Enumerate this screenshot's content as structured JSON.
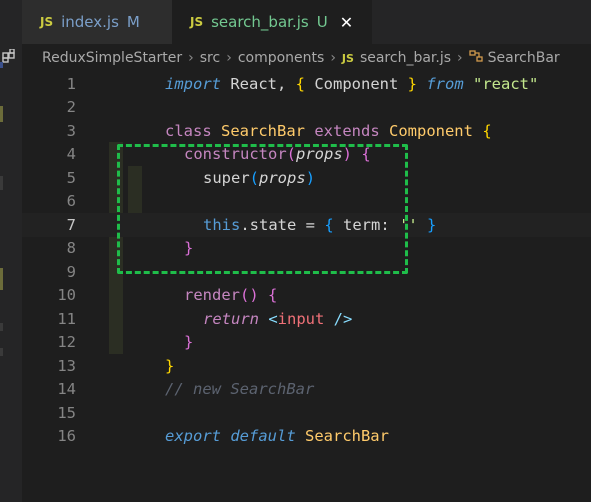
{
  "tabs": [
    {
      "badge": "JS",
      "name": "index.js",
      "status": "M"
    },
    {
      "badge": "JS",
      "name": "search_bar.js",
      "status": "U",
      "close": "✕"
    }
  ],
  "breadcrumb": {
    "parts": [
      "ReduxSimpleStarter",
      "src",
      "components"
    ],
    "file_badge": "JS",
    "file": "search_bar.js",
    "symbol": "SearchBar",
    "sep": "›"
  },
  "editor": {
    "line_numbers": [
      "1",
      "2",
      "3",
      "4",
      "5",
      "6",
      "7",
      "8",
      "9",
      "10",
      "11",
      "12",
      "13",
      "14",
      "15",
      "16"
    ],
    "current_line": "7",
    "lines": {
      "l1": {
        "import": "import",
        "react": " React, ",
        "ob": "{",
        "comp": " Component ",
        "cb": "}",
        "from": " from",
        "str": " \"react\""
      },
      "l3": {
        "class": "class",
        "name": " SearchBar",
        "extends": " extends",
        "comp": " Component",
        "ob": " {"
      },
      "l4": {
        "ctor": "constructor",
        "op": "(",
        "props": "props",
        "cp": ")",
        "ob": " {"
      },
      "l5": {
        "super": "super",
        "op": "(",
        "props": "props",
        "cp": ")"
      },
      "l7": {
        "this": "this",
        "state": ".state = ",
        "ob": "{",
        "term": " term: ",
        "str": "''",
        "cb": " }"
      },
      "l8": {
        "cb": "}"
      },
      "l10": {
        "render": "render",
        "parens": "()",
        "ob": " {"
      },
      "l11": {
        "ret": "return",
        "lt": " <",
        "tag": "input",
        "end": " />"
      },
      "l12": {
        "cb": "}"
      },
      "l13": {
        "cb": "}"
      },
      "l14": {
        "comment": "// new SearchBar"
      },
      "l16": {
        "export": "export",
        "default": " default",
        "name": " SearchBar"
      }
    }
  }
}
